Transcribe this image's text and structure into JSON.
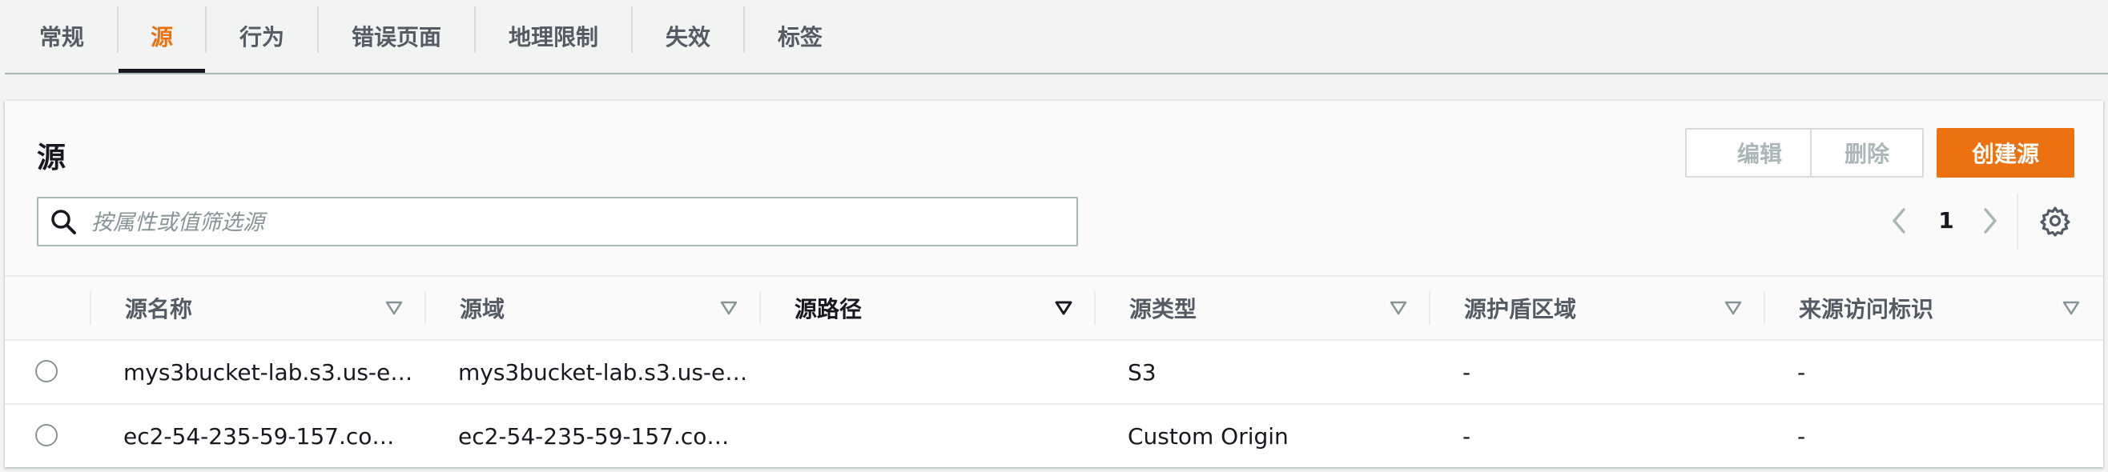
{
  "tabs": [
    {
      "label": "常规",
      "active": false
    },
    {
      "label": "源",
      "active": true
    },
    {
      "label": "行为",
      "active": false
    },
    {
      "label": "错误页面",
      "active": false
    },
    {
      "label": "地理限制",
      "active": false
    },
    {
      "label": "失效",
      "active": false
    },
    {
      "label": "标签",
      "active": false
    }
  ],
  "panel": {
    "title": "源",
    "buttons": {
      "edit": "编辑",
      "delete": "删除",
      "create": "创建源"
    },
    "search_placeholder": "按属性或值筛选源",
    "pagination": {
      "page": "1"
    }
  },
  "table": {
    "columns": [
      "源名称",
      "源域",
      "源路径",
      "源类型",
      "源护盾区域",
      "来源访问标识"
    ],
    "sorted_column": "源路径",
    "rows": [
      {
        "name": "mys3bucket-lab.s3.us-e…",
        "domain": "mys3bucket-lab.s3.us-e…",
        "path": "",
        "type": "S3",
        "shield": "-",
        "oai": "-"
      },
      {
        "name": "ec2-54-235-59-157.co…",
        "domain": "ec2-54-235-59-157.co…",
        "path": "",
        "type": "Custom Origin",
        "shield": "-",
        "oai": "-"
      }
    ]
  },
  "colors": {
    "accent": "#ec7211",
    "text": "#16191f",
    "muted": "#545b64",
    "border": "#eaeded"
  },
  "icons": {
    "search": "search-icon",
    "prev": "chevron-left-icon",
    "next": "chevron-right-icon",
    "settings": "gear-icon",
    "sort": "caret-down-icon"
  }
}
